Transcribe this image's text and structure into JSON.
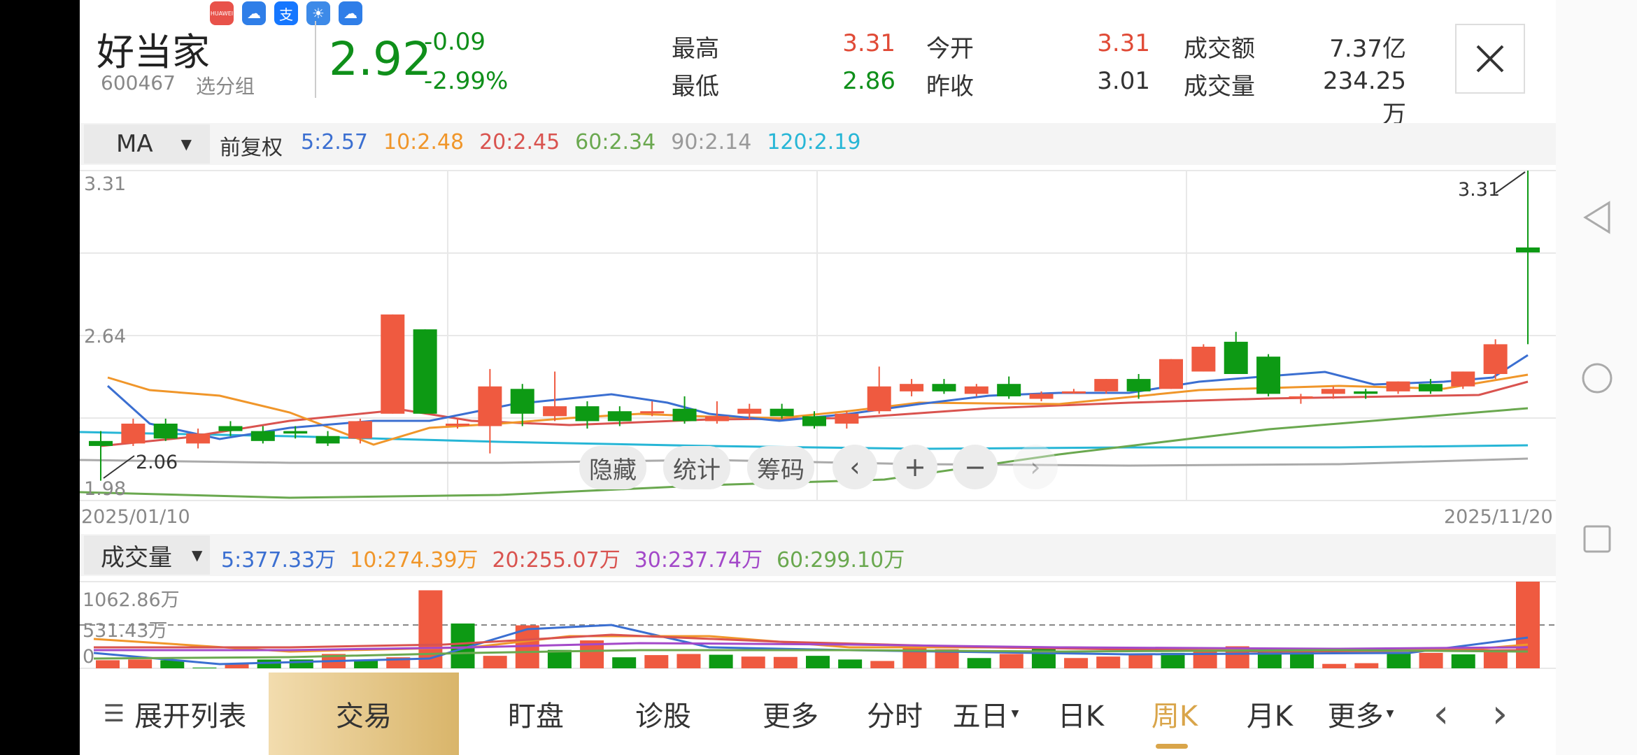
{
  "header": {
    "name": "好当家",
    "code": "600467",
    "group_label": "选分组",
    "price": "2.92",
    "change": "-0.09",
    "change_pct": "-2.99%",
    "stats": [
      {
        "label": "最高",
        "value": "3.31",
        "color": "#e04a36"
      },
      {
        "label": "今开",
        "value": "3.31",
        "color": "#e04a36"
      },
      {
        "label": "成交额",
        "value": "7.37亿",
        "color": "#333333"
      },
      {
        "label": "最低",
        "value": "2.86",
        "color": "#0f8f1a"
      },
      {
        "label": "昨收",
        "value": "3.01",
        "color": "#333333"
      },
      {
        "label": "成交量",
        "value": "234.25万",
        "color": "#333333"
      }
    ],
    "close_icon": "close-icon",
    "app_icons": [
      "huawei-icon",
      "cloud-icon",
      "alipay-icon",
      "weather-icon",
      "cloud-icon"
    ],
    "huawei_text": "HUAWEI",
    "alipay_text": "支"
  },
  "ma_bar": {
    "selector": "MA",
    "adjust": "前复权",
    "items": [
      {
        "label": "5:2.57",
        "color": "#3b6fd1"
      },
      {
        "label": "10:2.48",
        "color": "#f0962a"
      },
      {
        "label": "20:2.45",
        "color": "#d9534f"
      },
      {
        "label": "60:2.34",
        "color": "#6aa84f"
      },
      {
        "label": "90:2.14",
        "color": "#999999"
      },
      {
        "label": "120:2.19",
        "color": "#27b6d6"
      }
    ]
  },
  "price_chart": {
    "y_max_label": "3.31",
    "y_mid_label": "2.64",
    "y_min_label": "1.98",
    "low_marker": "2.06",
    "high_marker": "3.31",
    "date_start": "2025/01/10",
    "date_end": "2025/11/20"
  },
  "chart_controls": {
    "hide": "隐藏",
    "stats": "统计",
    "chips": "筹码",
    "prev_icon": "chevron-left-icon",
    "zoom_in_icon": "plus-icon",
    "zoom_out_icon": "minus-icon",
    "next_icon": "chevron-right-icon",
    "prev": "‹",
    "zoom_in": "+",
    "zoom_out": "−",
    "next": "›"
  },
  "volume_bar": {
    "selector": "成交量",
    "items": [
      {
        "label": "5:377.33万",
        "color": "#3b6fd1"
      },
      {
        "label": "10:274.39万",
        "color": "#f0962a"
      },
      {
        "label": "20:255.07万",
        "color": "#d9534f"
      },
      {
        "label": "30:237.74万",
        "color": "#a349c9"
      },
      {
        "label": "60:299.10万",
        "color": "#6aa84f"
      }
    ],
    "y_max_label": "1062.86万",
    "y_mid_label": "531.43万",
    "y_zero_label": "0"
  },
  "bottom_tabs": {
    "expand": "展开列表",
    "trade": "交易",
    "watch": "盯盘",
    "diagnose": "诊股",
    "more": "更多",
    "intraday": "分时",
    "five_day": "五日",
    "daily": "日K",
    "weekly": "周K",
    "monthly": "月K",
    "more2": "更多",
    "prev": "‹",
    "next": "›"
  },
  "android_nav": {
    "back_icon": "back-triangle-icon",
    "home_icon": "home-circle-icon",
    "recents_icon": "recents-square-icon"
  },
  "chart_data": {
    "type": "candlestick",
    "y_range": [
      1.98,
      3.31
    ],
    "date_start": "2025/01/10",
    "date_end": "2025/11/20",
    "candles": [
      {
        "o": 2.22,
        "c": 2.2,
        "h": 2.26,
        "l": 2.06
      },
      {
        "o": 2.21,
        "c": 2.29,
        "h": 2.31,
        "l": 2.2
      },
      {
        "o": 2.29,
        "c": 2.23,
        "h": 2.31,
        "l": 2.22
      },
      {
        "o": 2.21,
        "c": 2.25,
        "h": 2.27,
        "l": 2.19
      },
      {
        "o": 2.28,
        "c": 2.26,
        "h": 2.3,
        "l": 2.24
      },
      {
        "o": 2.26,
        "c": 2.22,
        "h": 2.28,
        "l": 2.21
      },
      {
        "o": 2.26,
        "c": 2.25,
        "h": 2.28,
        "l": 2.23
      },
      {
        "o": 2.24,
        "c": 2.21,
        "h": 2.26,
        "l": 2.2
      },
      {
        "o": 2.23,
        "c": 2.3,
        "h": 2.31,
        "l": 2.21
      },
      {
        "o": 2.33,
        "c": 2.73,
        "h": 2.73,
        "l": 2.33
      },
      {
        "o": 2.67,
        "c": 2.33,
        "h": 2.67,
        "l": 2.33
      },
      {
        "o": 2.29,
        "c": 2.29,
        "h": 2.31,
        "l": 2.27
      },
      {
        "o": 2.28,
        "c": 2.44,
        "h": 2.51,
        "l": 2.17
      },
      {
        "o": 2.43,
        "c": 2.33,
        "h": 2.45,
        "l": 2.28
      },
      {
        "o": 2.32,
        "c": 2.36,
        "h": 2.5,
        "l": 2.3
      },
      {
        "o": 2.36,
        "c": 2.3,
        "h": 2.38,
        "l": 2.27
      },
      {
        "o": 2.34,
        "c": 2.3,
        "h": 2.36,
        "l": 2.28
      },
      {
        "o": 2.34,
        "c": 2.34,
        "h": 2.38,
        "l": 2.32
      },
      {
        "o": 2.35,
        "c": 2.3,
        "h": 2.4,
        "l": 2.29
      },
      {
        "o": 2.3,
        "c": 2.32,
        "h": 2.38,
        "l": 2.29
      },
      {
        "o": 2.33,
        "c": 2.35,
        "h": 2.37,
        "l": 2.31
      },
      {
        "o": 2.35,
        "c": 2.32,
        "h": 2.37,
        "l": 2.31
      },
      {
        "o": 2.32,
        "c": 2.28,
        "h": 2.34,
        "l": 2.27
      },
      {
        "o": 2.29,
        "c": 2.33,
        "h": 2.34,
        "l": 2.27
      },
      {
        "o": 2.34,
        "c": 2.44,
        "h": 2.52,
        "l": 2.33
      },
      {
        "o": 2.42,
        "c": 2.45,
        "h": 2.47,
        "l": 2.4
      },
      {
        "o": 2.45,
        "c": 2.42,
        "h": 2.47,
        "l": 2.41
      },
      {
        "o": 2.41,
        "c": 2.44,
        "h": 2.45,
        "l": 2.4
      },
      {
        "o": 2.45,
        "c": 2.4,
        "h": 2.48,
        "l": 2.39
      },
      {
        "o": 2.39,
        "c": 2.41,
        "h": 2.42,
        "l": 2.38
      },
      {
        "o": 2.42,
        "c": 2.42,
        "h": 2.43,
        "l": 2.41
      },
      {
        "o": 2.42,
        "c": 2.47,
        "h": 2.47,
        "l": 2.41
      },
      {
        "o": 2.47,
        "c": 2.42,
        "h": 2.49,
        "l": 2.39
      },
      {
        "o": 2.43,
        "c": 2.55,
        "h": 2.55,
        "l": 2.43
      },
      {
        "o": 2.5,
        "c": 2.6,
        "h": 2.61,
        "l": 2.5
      },
      {
        "o": 2.62,
        "c": 2.49,
        "h": 2.66,
        "l": 2.49
      },
      {
        "o": 2.56,
        "c": 2.41,
        "h": 2.57,
        "l": 2.4
      },
      {
        "o": 2.4,
        "c": 2.4,
        "h": 2.41,
        "l": 2.37
      },
      {
        "o": 2.41,
        "c": 2.43,
        "h": 2.44,
        "l": 2.39
      },
      {
        "o": 2.42,
        "c": 2.41,
        "h": 2.43,
        "l": 2.39
      },
      {
        "o": 2.42,
        "c": 2.46,
        "h": 2.46,
        "l": 2.41
      },
      {
        "o": 2.45,
        "c": 2.42,
        "h": 2.47,
        "l": 2.41
      },
      {
        "o": 2.44,
        "c": 2.5,
        "h": 2.5,
        "l": 2.43
      },
      {
        "o": 2.49,
        "c": 2.61,
        "h": 2.63,
        "l": 2.47
      },
      {
        "o": 3.0,
        "c": 2.98,
        "h": 3.31,
        "l": 2.61
      }
    ],
    "volumes": [
      {
        "v": 110,
        "up": true
      },
      {
        "v": 120,
        "up": true
      },
      {
        "v": 110,
        "up": false
      },
      {
        "v": 10,
        "up": false
      },
      {
        "v": 70,
        "up": true
      },
      {
        "v": 120,
        "up": false
      },
      {
        "v": 120,
        "up": false
      },
      {
        "v": 195,
        "up": true
      },
      {
        "v": 110,
        "up": false
      },
      {
        "v": 150,
        "up": true
      },
      {
        "v": 1062,
        "up": true
      },
      {
        "v": 610,
        "up": false
      },
      {
        "v": 170,
        "up": true
      },
      {
        "v": 585,
        "up": true
      },
      {
        "v": 250,
        "up": false
      },
      {
        "v": 380,
        "up": true
      },
      {
        "v": 150,
        "up": false
      },
      {
        "v": 180,
        "up": true
      },
      {
        "v": 195,
        "up": true
      },
      {
        "v": 185,
        "up": false
      },
      {
        "v": 160,
        "up": true
      },
      {
        "v": 155,
        "up": true
      },
      {
        "v": 170,
        "up": false
      },
      {
        "v": 120,
        "up": false
      },
      {
        "v": 100,
        "up": true
      },
      {
        "v": 320,
        "up": true
      },
      {
        "v": 260,
        "up": true
      },
      {
        "v": 140,
        "up": false
      },
      {
        "v": 195,
        "up": true
      },
      {
        "v": 275,
        "up": false
      },
      {
        "v": 140,
        "up": true
      },
      {
        "v": 160,
        "up": true
      },
      {
        "v": 180,
        "up": true
      },
      {
        "v": 210,
        "up": false
      },
      {
        "v": 260,
        "up": true
      },
      {
        "v": 300,
        "up": true
      },
      {
        "v": 270,
        "up": false
      },
      {
        "v": 220,
        "up": false
      },
      {
        "v": 60,
        "up": true
      },
      {
        "v": 70,
        "up": true
      },
      {
        "v": 200,
        "up": false
      },
      {
        "v": 210,
        "up": true
      },
      {
        "v": 190,
        "up": false
      },
      {
        "v": 230,
        "up": true
      },
      {
        "v": 1180,
        "up": true
      }
    ]
  }
}
